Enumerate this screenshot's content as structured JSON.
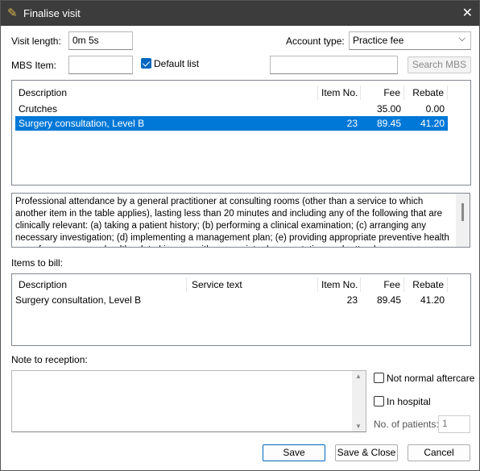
{
  "window": {
    "title": "Finalise visit",
    "icon": "app-logo-icon",
    "close_icon": "close-icon"
  },
  "form": {
    "visit_length_label": "Visit length:",
    "visit_length_value": "0m  5s",
    "account_type_label": "Account type:",
    "account_type_value": "Practice fee",
    "mbs_item_label": "MBS Item:",
    "mbs_item_value": "",
    "default_list_label": "Default list",
    "default_list_checked": true,
    "search_value": "",
    "search_button": "Search MBS"
  },
  "items_list": {
    "columns": [
      "Description",
      "Item No.",
      "Fee",
      "Rebate"
    ],
    "rows": [
      {
        "description": "Crutches",
        "item_no": "",
        "fee": "35.00",
        "rebate": "0.00",
        "selected": false
      },
      {
        "description": "Surgery consultation, Level B",
        "item_no": "23",
        "fee": "89.45",
        "rebate": "41.20",
        "selected": true
      }
    ]
  },
  "item_description": "Professional attendance by a general practitioner at consulting rooms (other than a service to which another item in the table applies), lasting less than 20 minutes and including any of the following that are clinically relevant: (a) taking a patient history; (b) performing a clinical examination; (c) arranging any necessary investigation; (d) implementing a management plan; (e) providing appropriate preventive health care; for one or more health-related issues, with appropriate documentation-each attendance",
  "bill": {
    "label": "Items to bill:",
    "columns": [
      "Description",
      "Service text",
      "Item No.",
      "Fee",
      "Rebate"
    ],
    "rows": [
      {
        "description": "Surgery consultation, Level B",
        "service_text": "",
        "item_no": "23",
        "fee": "89.45",
        "rebate": "41.20"
      }
    ]
  },
  "note": {
    "label": "Note to reception:",
    "value": ""
  },
  "options": {
    "not_normal_aftercare": "Not normal aftercare",
    "in_hospital": "In hospital",
    "patients_label": "No. of patients:",
    "patients_value": "1"
  },
  "buttons": {
    "save": "Save",
    "save_close": "Save & Close",
    "cancel": "Cancel"
  },
  "colors": {
    "selection": "#0078d7",
    "titlebar": "#3c3c3c"
  }
}
